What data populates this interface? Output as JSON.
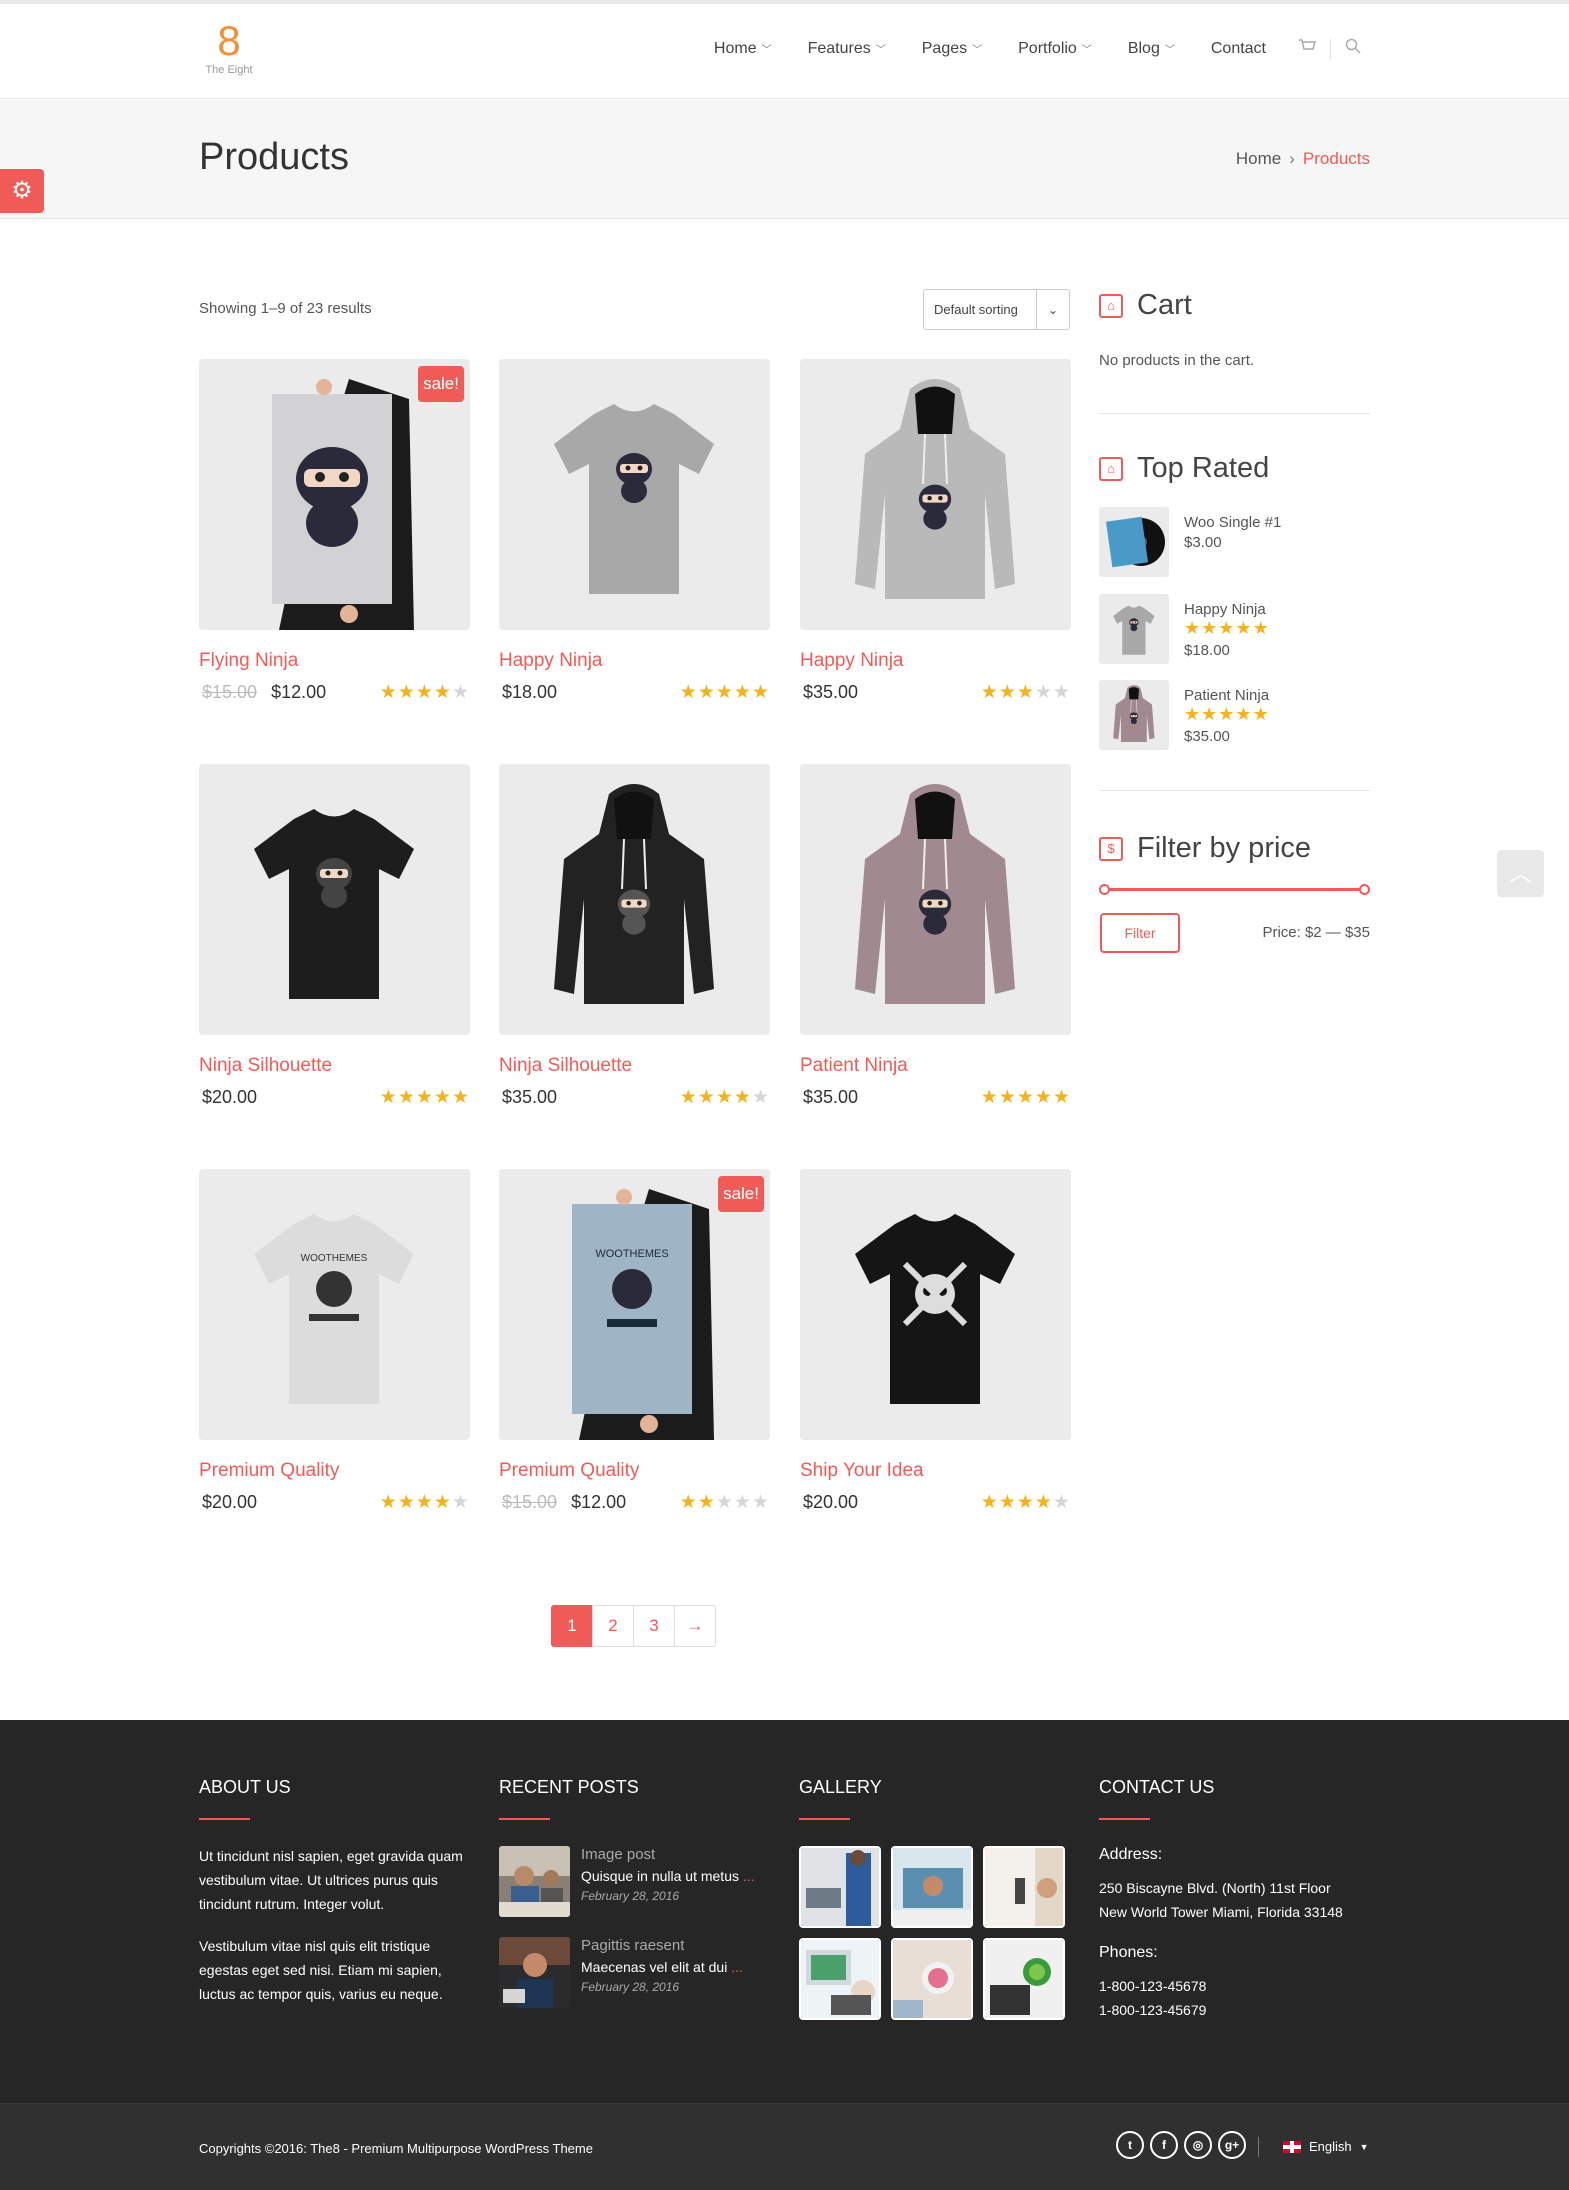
{
  "header": {
    "logo_mark": "8",
    "logo_text": "The Eight",
    "nav": [
      {
        "label": "Home",
        "dropdown": true
      },
      {
        "label": "Features",
        "dropdown": true
      },
      {
        "label": "Pages",
        "dropdown": true
      },
      {
        "label": "Portfolio",
        "dropdown": true
      },
      {
        "label": "Blog",
        "dropdown": true
      },
      {
        "label": "Contact",
        "dropdown": false
      }
    ]
  },
  "titlebar": {
    "title": "Products",
    "breadcrumb": [
      "Home",
      "Products"
    ]
  },
  "shop": {
    "showing": "Showing 1–9 of 23 results",
    "sorting": "Default sorting",
    "sale_label": "sale!",
    "products": [
      {
        "name": "Flying Ninja",
        "old_price": "$15.00",
        "price": "$12.00",
        "rating": 4,
        "sale": true,
        "image": "poster-ninja"
      },
      {
        "name": "Happy Ninja",
        "old_price": "",
        "price": "$18.00",
        "rating": 5,
        "sale": false,
        "image": "tshirt-grey-ninja"
      },
      {
        "name": "Happy Ninja",
        "old_price": "",
        "price": "$35.00",
        "rating": 3,
        "sale": false,
        "image": "hoodie-grey-ninja"
      },
      {
        "name": "Ninja Silhouette",
        "old_price": "",
        "price": "$20.00",
        "rating": 5,
        "sale": false,
        "image": "tshirt-black-ninja"
      },
      {
        "name": "Ninja Silhouette",
        "old_price": "",
        "price": "$35.00",
        "rating": 4,
        "sale": false,
        "image": "hoodie-black-ninja"
      },
      {
        "name": "Patient Ninja",
        "old_price": "",
        "price": "$35.00",
        "rating": 4.8,
        "sale": false,
        "image": "hoodie-pink-ninja"
      },
      {
        "name": "Premium Quality",
        "old_price": "",
        "price": "$20.00",
        "rating": 4.5,
        "sale": false,
        "image": "tshirt-white-woothemes"
      },
      {
        "name": "Premium Quality",
        "old_price": "$15.00",
        "price": "$12.00",
        "rating": 2,
        "sale": true,
        "image": "poster-woothemes"
      },
      {
        "name": "Ship Your Idea",
        "old_price": "",
        "price": "$20.00",
        "rating": 4,
        "sale": false,
        "image": "tshirt-black-skull"
      }
    ],
    "pagination": [
      "1",
      "2",
      "3",
      "→"
    ]
  },
  "sidebar": {
    "cart_title": "Cart",
    "cart_empty": "No products in the cart.",
    "top_rated_title": "Top Rated",
    "top_rated": [
      {
        "name": "Woo Single #1",
        "price": "$3.00",
        "rating": 0,
        "image": "vinyl-album"
      },
      {
        "name": "Happy Ninja",
        "price": "$18.00",
        "rating": 5,
        "image": "tshirt-grey-ninja"
      },
      {
        "name": "Patient Ninja",
        "price": "$35.00",
        "rating": 4.8,
        "image": "hoodie-pink-ninja"
      }
    ],
    "filter_title": "Filter by price",
    "filter_button": "Filter",
    "price_range": "Price: $2 — $35"
  },
  "footer": {
    "about_title": "ABOUT US",
    "about_p1": "Ut tincidunt nisl sapien, eget gravida quam vestibulum vitae. Ut ultrices purus quis tincidunt rutrum. Integer volut.",
    "about_p2": "Vestibulum vitae nisl quis elit tristique egestas eget sed nisi. Etiam mi sapien, luctus ac tempor quis, varius eu neque.",
    "recent_title": "RECENT POSTS",
    "posts": [
      {
        "category": "Image post",
        "title": "Quisque in nulla ut metus",
        "date": "February 28, 2016"
      },
      {
        "category": "Pagittis raesent",
        "title": "Maecenas vel elit at dui",
        "date": "February 28, 2016"
      }
    ],
    "gallery_title": "GALLERY",
    "contact_title": "CONTACT US",
    "address_label": "Address:",
    "address_line1": "250 Biscayne Blvd. (North) 11st Floor",
    "address_line2": "New World Tower Miami, Florida 33148",
    "phones_label": "Phones:",
    "phone1": "1-800-123-45678",
    "phone2": "1-800-123-45679",
    "copyright": "Copyrights ©2016: The8 - Premium Multipurpose WordPress Theme",
    "language": "English",
    "ellipsis": "..."
  },
  "colors": {
    "accent": "#f05b57",
    "star": "#f5b21c",
    "footer_bg": "#262626"
  }
}
